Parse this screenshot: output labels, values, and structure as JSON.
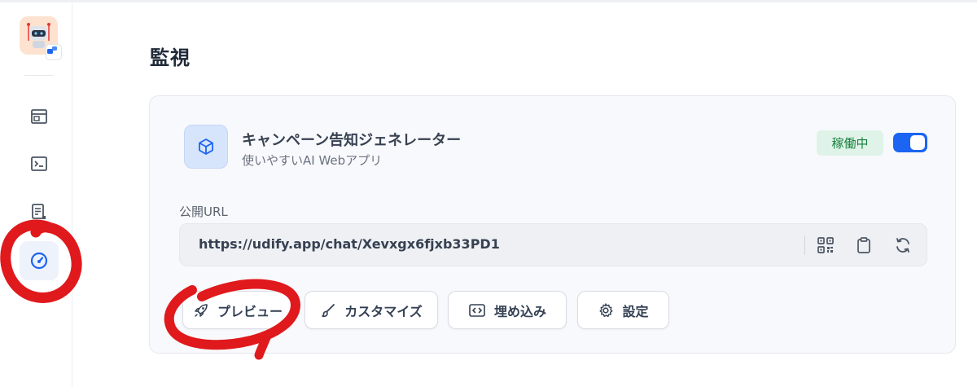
{
  "page": {
    "title": "監視"
  },
  "app": {
    "name": "キャンペーン告知ジェネレーター",
    "description": "使いやすいAI Webアプリ",
    "status": "稼働中",
    "enabled": true
  },
  "public_url": {
    "label": "公開URL",
    "value": "https://udify.app/chat/Xevxgx6fjxb33PD1"
  },
  "actions": [
    {
      "label": "プレビュー",
      "icon": "rocket-icon"
    },
    {
      "label": "カスタマイズ",
      "icon": "paintbrush-icon"
    },
    {
      "label": "埋め込み",
      "icon": "embed-code-icon"
    },
    {
      "label": "設定",
      "icon": "gear-icon"
    }
  ],
  "sidebar": {
    "items": [
      {
        "icon": "browser-window-icon"
      },
      {
        "icon": "terminal-icon"
      },
      {
        "icon": "document-icon"
      },
      {
        "icon": "speedometer-icon",
        "active": true
      }
    ]
  },
  "url_tools": [
    "qr-code-icon",
    "clipboard-icon",
    "refresh-icon"
  ],
  "colors": {
    "accent": "#1c64f2",
    "status_bg": "#dff3e8",
    "status_text": "#17803d",
    "annotation": "#e0191d"
  }
}
